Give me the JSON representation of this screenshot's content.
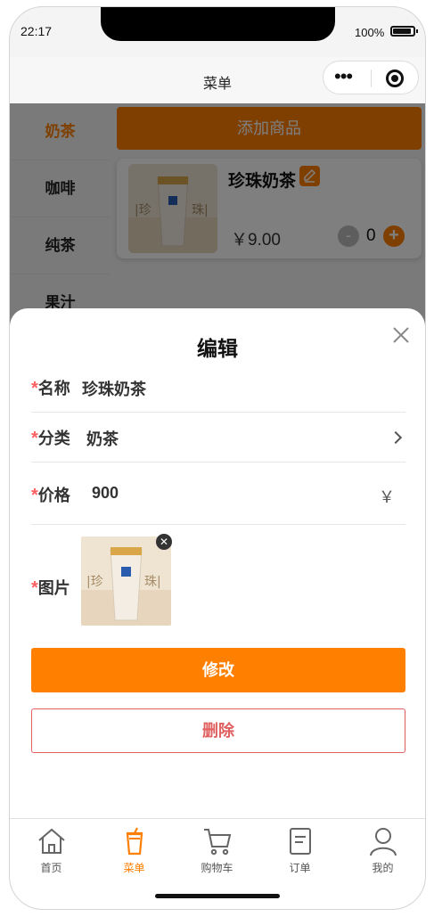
{
  "status_bar": {
    "time": "22:17",
    "battery": "100%"
  },
  "navbar": {
    "title": "菜单"
  },
  "sidebar": {
    "items": [
      {
        "label": "奶茶",
        "active": true
      },
      {
        "label": "咖啡"
      },
      {
        "label": "纯茶"
      },
      {
        "label": "果汁"
      }
    ]
  },
  "main": {
    "add_button": "添加商品",
    "product": {
      "name": "珍珠奶茶",
      "price": "￥9.00",
      "qty": "0",
      "minus": "-",
      "plus": "+"
    }
  },
  "edit_sheet": {
    "title": "编辑",
    "required_mark": "*",
    "name_label": "名称",
    "name_value": "珍珠奶茶",
    "category_label": "分类",
    "category_value": "奶茶",
    "price_label": "价格",
    "price_value": "900",
    "price_unit": "￥",
    "image_label": "图片",
    "image_close": "✕",
    "modify_button": "修改",
    "delete_button": "删除"
  },
  "tabbar": {
    "items": [
      {
        "label": "首页",
        "icon": "home-icon"
      },
      {
        "label": "菜单",
        "icon": "drink-cup-icon",
        "active": true
      },
      {
        "label": "购物车",
        "icon": "cart-icon"
      },
      {
        "label": "订单",
        "icon": "order-icon"
      },
      {
        "label": "我的",
        "icon": "user-icon"
      }
    ]
  },
  "colors": {
    "accent": "#ff7f00",
    "danger": "#e06060",
    "required": "#ff5f5f"
  }
}
